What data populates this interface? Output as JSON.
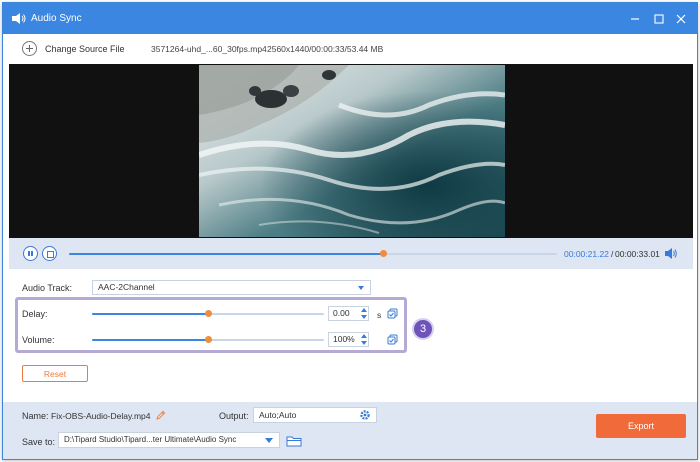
{
  "window": {
    "title": "Audio Sync",
    "accent_color": "#3b86e0",
    "controls": [
      "minimize-icon",
      "maximize-icon",
      "close-icon"
    ]
  },
  "source": {
    "change_label": "Change Source File",
    "file_name": "3571264-uhd_...60_30fps.mp4",
    "file_info": "2560x1440/00:00:33/53.44 MB"
  },
  "playback": {
    "current_time": "00:00:21.22",
    "separator": "/",
    "total_time": "00:00:33.01",
    "progress_fraction": 0.643
  },
  "settings": {
    "audio_track_label": "Audio Track:",
    "audio_track_value": "AAC-2Channel",
    "delay_label": "Delay:",
    "delay_value": "0.00",
    "delay_unit": "s",
    "delay_slider_fraction": 0.5,
    "volume_label": "Volume:",
    "volume_value": "100%",
    "volume_slider_fraction": 0.5,
    "step_badge": "3",
    "reset_label": "Reset"
  },
  "output": {
    "name_label": "Name:",
    "name_value": "Fix-OBS-Audio-Delay.mp4",
    "output_label": "Output:",
    "output_value": "Auto;Auto",
    "save_label": "Save to:",
    "save_value": "D:\\Tipard Studio\\Tipard...ter Ultimate\\Audio Sync",
    "export_label": "Export",
    "export_color": "#f06a3a"
  }
}
